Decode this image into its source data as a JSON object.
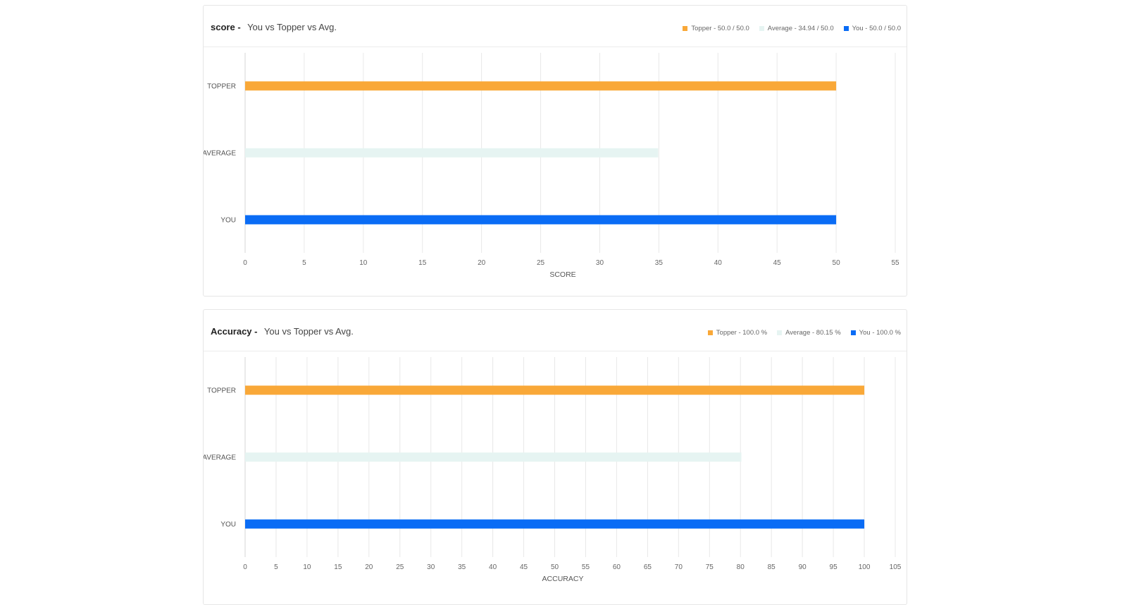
{
  "charts": [
    {
      "metric": "score",
      "separator": "-",
      "subtitle": "You vs Topper vs Avg.",
      "legend": [
        {
          "label": "Topper - 50.0 / 50.0",
          "color": "#f9a838"
        },
        {
          "label": "Average - 34.94 / 50.0",
          "color": "#e6f4f2"
        },
        {
          "label": "You - 50.0 / 50.0",
          "color": "#0a6cf5"
        }
      ]
    },
    {
      "metric": "Accuracy",
      "separator": "-",
      "subtitle": "You vs Topper vs Avg.",
      "legend": [
        {
          "label": "Topper - 100.0 %",
          "color": "#f9a838"
        },
        {
          "label": "Average - 80.15 %",
          "color": "#e6f4f2"
        },
        {
          "label": "You - 100.0 %",
          "color": "#0a6cf5"
        }
      ]
    }
  ],
  "chart_data": [
    {
      "type": "bar",
      "orientation": "horizontal",
      "categories": [
        "TOPPER",
        "AVERAGE",
        "YOU"
      ],
      "values": [
        50.0,
        34.94,
        50.0
      ],
      "colors": [
        "#f9a838",
        "#e6f4f2",
        "#0a6cf5"
      ],
      "xlabel": "SCORE",
      "xlim": [
        0,
        55
      ],
      "xticks": [
        0,
        5,
        10,
        15,
        20,
        25,
        30,
        35,
        40,
        45,
        50,
        55
      ],
      "grid": "vertical"
    },
    {
      "type": "bar",
      "orientation": "horizontal",
      "categories": [
        "TOPPER",
        "AVERAGE",
        "YOU"
      ],
      "values": [
        100.0,
        80.15,
        100.0
      ],
      "colors": [
        "#f9a838",
        "#e6f4f2",
        "#0a6cf5"
      ],
      "xlabel": "ACCURACY",
      "xlim": [
        0,
        105
      ],
      "xticks": [
        0,
        5,
        10,
        15,
        20,
        25,
        30,
        35,
        40,
        45,
        50,
        55,
        60,
        65,
        70,
        75,
        80,
        85,
        90,
        95,
        100,
        105
      ],
      "grid": "vertical"
    }
  ]
}
